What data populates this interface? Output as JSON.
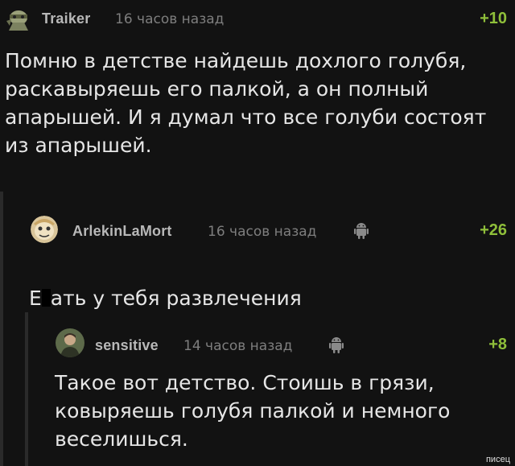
{
  "comments": [
    {
      "author": "Traiker",
      "time": "16 часов назад",
      "rating": "+10",
      "avatar_icon": "character-avatar-icon",
      "text": "Помню в детстве найдешь дохлого голубя,\nраскавыряешь его палкой, а  он полный\nапарышей.  И я думал что все голуби состоят\nиз апарышей."
    },
    {
      "author": "ArlekinLaMort",
      "time": "16 часов назад",
      "rating": "+26",
      "avatar_icon": "cartoon-face-avatar-icon",
      "platform_icon": "android-icon",
      "text_pre": "Е",
      "text_post": "ать у тебя развлечения"
    },
    {
      "author": "sensitive",
      "time": "14 часов назад",
      "rating": "+8",
      "avatar_icon": "person-photo-avatar-icon",
      "platform_icon": "android-icon",
      "text": "Такое вот детство. Стоишь в грязи,\nковыряешь голубя палкой и немного\nвеселишься."
    }
  ],
  "watermark": "писец",
  "colors": {
    "background": "#121212",
    "rating": "#8fbf3a",
    "author": "#b8b8b8",
    "time": "#7e7e7e",
    "text": "#e6e6e6"
  }
}
